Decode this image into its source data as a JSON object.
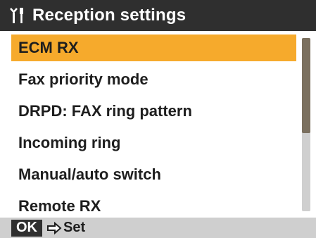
{
  "title_bar": {
    "icon": "settings-icon",
    "title": "Reception settings"
  },
  "menu": {
    "items": [
      {
        "label": "ECM RX",
        "selected": true
      },
      {
        "label": "Fax priority mode",
        "selected": false
      },
      {
        "label": "DRPD: FAX ring pattern",
        "selected": false
      },
      {
        "label": "Incoming ring",
        "selected": false
      },
      {
        "label": "Manual/auto switch",
        "selected": false
      },
      {
        "label": "Remote RX",
        "selected": false
      }
    ]
  },
  "bottom_bar": {
    "ok_label": "OK",
    "arrow_icon": "arrow-icon",
    "action_label": "Set"
  },
  "colors": {
    "title_bg": "#2f2f2f",
    "highlight": "#f6aa2c",
    "bottom_bg": "#cfcfcf",
    "scroll_thumb": "#7b705f"
  }
}
